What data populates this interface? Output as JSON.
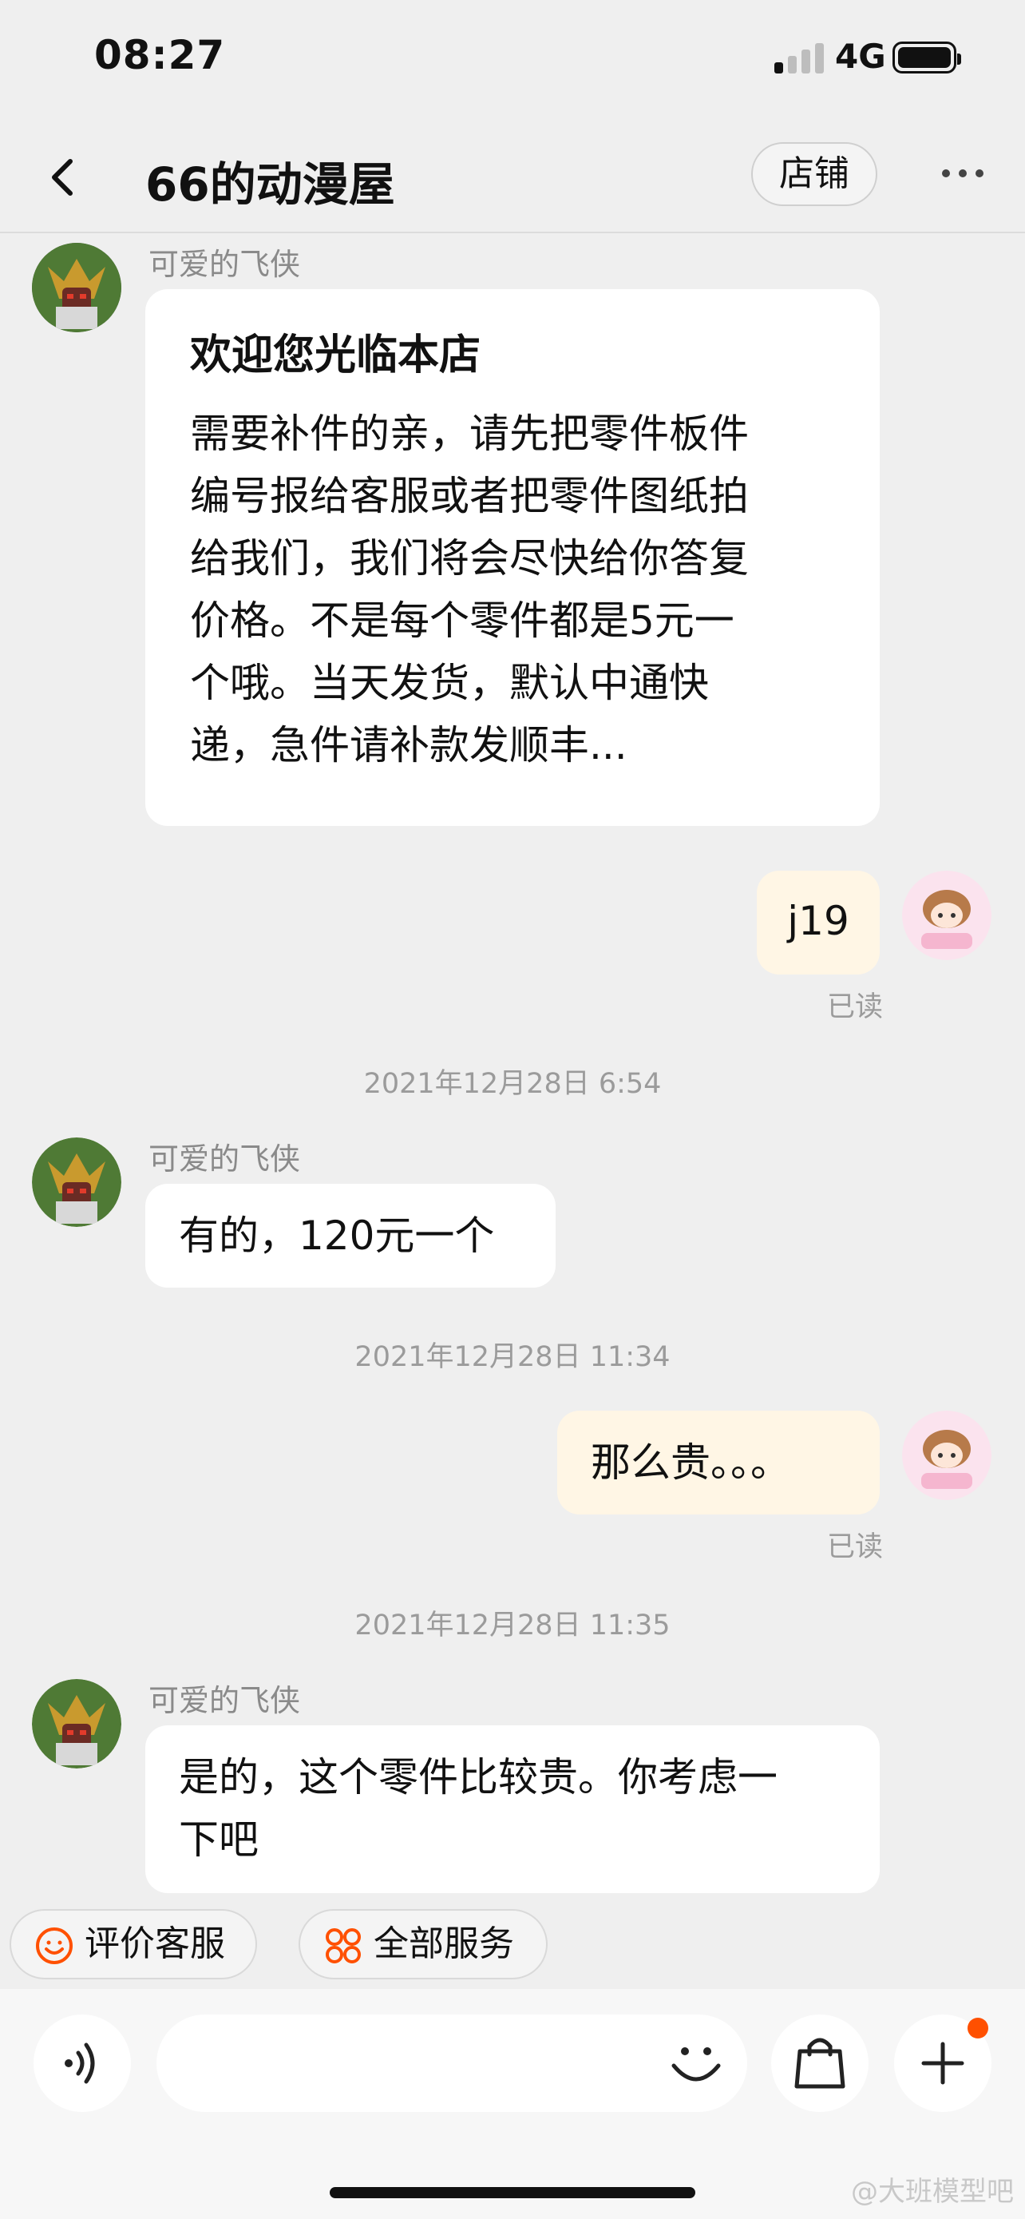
{
  "status_bar": {
    "time": "08:27",
    "network": "4G",
    "signal_bars_active": 1
  },
  "nav": {
    "title": "66的动漫屋",
    "store_label": "店铺"
  },
  "colors": {
    "accent": "#ff5000",
    "my_bubble": "#fff6e5",
    "background": "#efefef"
  },
  "messages": [
    {
      "from": "可爱的飞侠",
      "title": "欢迎您光临本店",
      "lines": [
        "需要补件的亲，请先把零件板件",
        "编号报给客服或者把零件图纸拍",
        "给我们，我们将会尽快给你答复",
        "价格。不是每个零件都是5元一",
        "个哦。当天发货，默认中通快",
        "递，急件请补款发顺丰..."
      ]
    },
    {
      "from": "me",
      "text": "j19",
      "status": "已读"
    },
    {
      "timestamp": "2021年12月28日 6:54"
    },
    {
      "from": "可爱的飞侠",
      "text": "有的，120元一个"
    },
    {
      "timestamp": "2021年12月28日 11:34"
    },
    {
      "from": "me",
      "text": "那么贵。。。",
      "status": "已读"
    },
    {
      "timestamp": "2021年12月28日 11:35"
    },
    {
      "from": "可爱的飞侠",
      "lines": [
        "是的，这个零件比较贵。你考虑一",
        "下吧"
      ]
    }
  ],
  "quick_actions": [
    {
      "label": "评价客服",
      "icon": "smile-face-icon"
    },
    {
      "label": "全部服务",
      "icon": "services-grid-icon"
    }
  ],
  "input": {
    "placeholder": ""
  },
  "watermark": "@大班模型吧"
}
